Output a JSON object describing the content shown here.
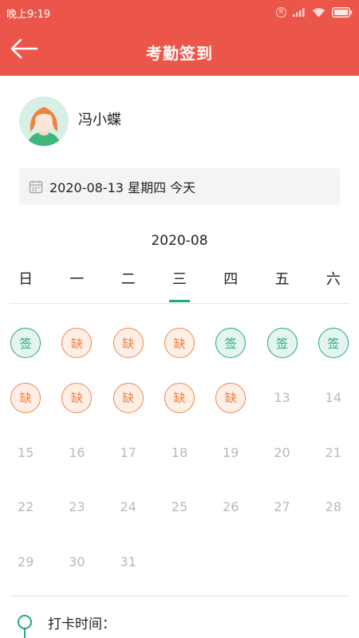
{
  "status_bar": {
    "time": "晚上9:19"
  },
  "header": {
    "title": "考勤签到"
  },
  "user": {
    "name": "冯小蝶"
  },
  "date_bar": {
    "text": "2020-08-13 星期四 今天"
  },
  "calendar": {
    "month": "2020-08",
    "weekdays": [
      "日",
      "一",
      "二",
      "三",
      "四",
      "五",
      "六"
    ],
    "selected_weekday_index": 3,
    "days": [
      {
        "text": "签",
        "type": "sign"
      },
      {
        "text": "缺",
        "type": "absent"
      },
      {
        "text": "缺",
        "type": "absent"
      },
      {
        "text": "缺",
        "type": "absent"
      },
      {
        "text": "签",
        "type": "sign"
      },
      {
        "text": "签",
        "type": "sign"
      },
      {
        "text": "签",
        "type": "sign"
      },
      {
        "text": "缺",
        "type": "absent"
      },
      {
        "text": "缺",
        "type": "absent"
      },
      {
        "text": "缺",
        "type": "absent"
      },
      {
        "text": "缺",
        "type": "absent"
      },
      {
        "text": "缺",
        "type": "absent"
      },
      {
        "text": "13",
        "type": "future"
      },
      {
        "text": "14",
        "type": "future"
      },
      {
        "text": "15",
        "type": "future"
      },
      {
        "text": "16",
        "type": "future"
      },
      {
        "text": "17",
        "type": "future"
      },
      {
        "text": "18",
        "type": "future"
      },
      {
        "text": "19",
        "type": "future"
      },
      {
        "text": "20",
        "type": "future"
      },
      {
        "text": "21",
        "type": "future"
      },
      {
        "text": "22",
        "type": "future"
      },
      {
        "text": "23",
        "type": "future"
      },
      {
        "text": "24",
        "type": "future"
      },
      {
        "text": "25",
        "type": "future"
      },
      {
        "text": "26",
        "type": "future"
      },
      {
        "text": "27",
        "type": "future"
      },
      {
        "text": "28",
        "type": "future"
      },
      {
        "text": "29",
        "type": "future"
      },
      {
        "text": "30",
        "type": "future"
      },
      {
        "text": "31",
        "type": "future"
      }
    ]
  },
  "punch": {
    "label": "打卡时间："
  },
  "colors": {
    "header": "#ec564a",
    "sign": "#23a97a",
    "absent": "#ef8243",
    "future": "#b9b9b9"
  },
  "icons": [
    "back-arrow-icon",
    "sim-r-icon",
    "signal-icon",
    "wifi-icon",
    "battery-icon",
    "calendar-icon",
    "avatar-girl-icon"
  ]
}
